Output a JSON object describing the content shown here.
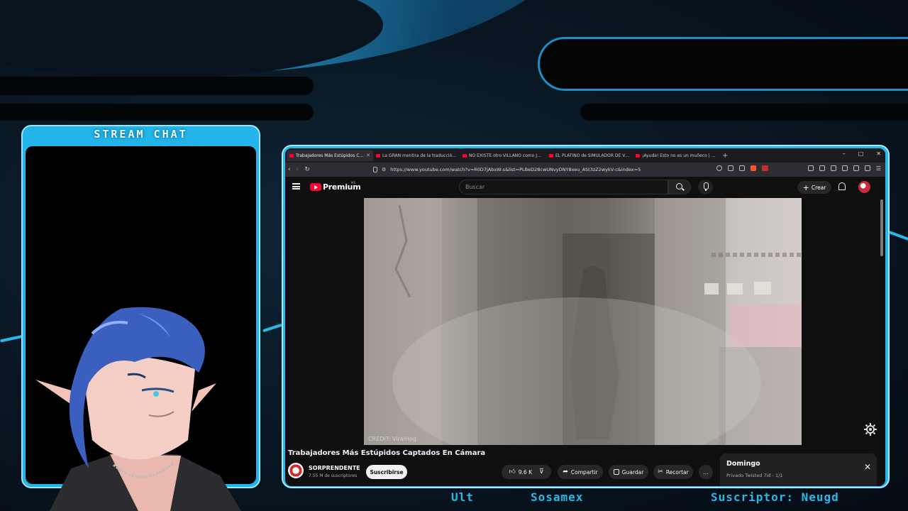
{
  "chat": {
    "title": "STREAM CHAT"
  },
  "browser": {
    "tabs": [
      {
        "title": "Trabajadores Más Estúpidos Captados En Cámara",
        "active": true
      },
      {
        "title": "La GRAN mentira de la traducción en español",
        "active": false
      },
      {
        "title": "NO EXISTE otro VILLANO como JOHN",
        "active": false
      },
      {
        "title": "EL PLATINO de SIMULADOR DE VACAS",
        "active": false
      },
      {
        "title": "¡Ayuda! Esto no es un muñeco | El entrenador",
        "active": false
      }
    ],
    "newtab": "+",
    "window_controls": [
      "–",
      "□",
      "✕"
    ],
    "url": "https://www.youtube.com/watch?v=R0D7jAbxW-s&list=PLBeD28cwUNvyDNY8xeu_ASt3zZ2wykV-c&index=5"
  },
  "youtube": {
    "brand": "Premium",
    "region": "MX",
    "search_placeholder": "Buscar",
    "create_label": "Crear",
    "video": {
      "credit": "CREDIT: ViralHog",
      "title": "Trabajadores Más Estúpidos Captados En Cámara",
      "channel": "SORPRENDENTE",
      "subscribers": "7.55 M de suscriptores",
      "subscribe_label": "Suscribirse",
      "likes": "9.6 K",
      "share_label": "Compartir",
      "save_label": "Guardar",
      "clip_label": "Recortar",
      "more_label": "…"
    },
    "playlist": {
      "title": "Domingo",
      "meta": "Privado  Twisted 7id - 1/1",
      "close_label": "✕"
    }
  },
  "overlay_bottom": {
    "left": "Ult",
    "center": "Sosamex",
    "right": "Suscriptor: Neugd"
  },
  "colors": {
    "accent": "#29b6e8",
    "youtube_red": "#ff0033"
  }
}
